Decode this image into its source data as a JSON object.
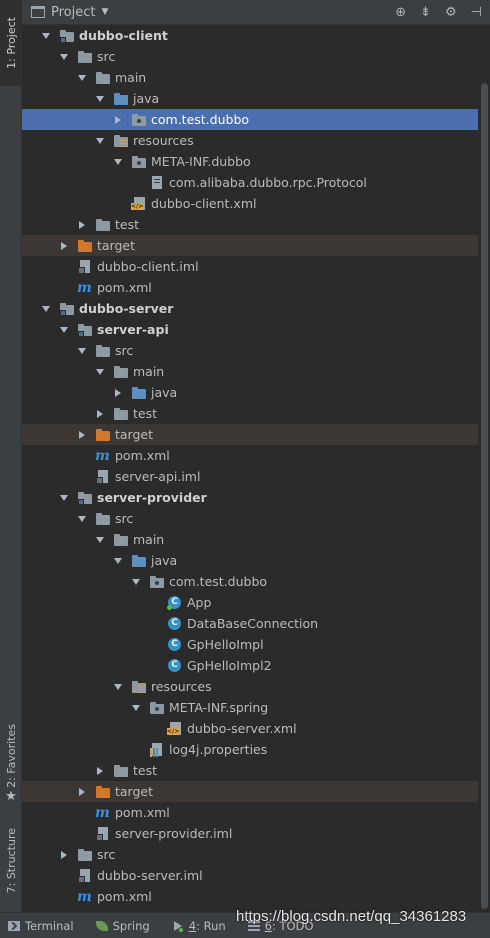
{
  "header": {
    "title": "Project"
  },
  "stripe": {
    "project": "1: Project",
    "favorites": "2: Favorites",
    "structure": "7: Structure"
  },
  "tree": [
    {
      "label": "dubbo-client",
      "indent": 0,
      "arrow": "down",
      "icon": "folder-module",
      "bold": true
    },
    {
      "label": "src",
      "indent": 1,
      "arrow": "down",
      "icon": "folder"
    },
    {
      "label": "main",
      "indent": 2,
      "arrow": "down",
      "icon": "folder"
    },
    {
      "label": "java",
      "indent": 3,
      "arrow": "down",
      "icon": "folder-java"
    },
    {
      "label": "com.test.dubbo",
      "indent": 4,
      "arrow": "right",
      "icon": "folder-package",
      "selected": true
    },
    {
      "label": "resources",
      "indent": 3,
      "arrow": "down",
      "icon": "folder-resources"
    },
    {
      "label": "META-INF.dubbo",
      "indent": 4,
      "arrow": "down",
      "icon": "folder-package"
    },
    {
      "label": "com.alibaba.dubbo.rpc.Protocol",
      "indent": 5,
      "arrow": "none",
      "icon": "file"
    },
    {
      "label": "dubbo-client.xml",
      "indent": 4,
      "arrow": "none",
      "icon": "xml"
    },
    {
      "label": "test",
      "indent": 2,
      "arrow": "right",
      "icon": "folder"
    },
    {
      "label": "target",
      "indent": 1,
      "arrow": "right",
      "icon": "folder-excluded",
      "excluded": true
    },
    {
      "label": "dubbo-client.iml",
      "indent": 1,
      "arrow": "none",
      "icon": "iml"
    },
    {
      "label": "pom.xml",
      "indent": 1,
      "arrow": "none",
      "icon": "maven"
    },
    {
      "label": "dubbo-server",
      "indent": 0,
      "arrow": "down",
      "icon": "folder-module",
      "bold": true
    },
    {
      "label": "server-api",
      "indent": 1,
      "arrow": "down",
      "icon": "folder-module",
      "bold": true
    },
    {
      "label": "src",
      "indent": 2,
      "arrow": "down",
      "icon": "folder"
    },
    {
      "label": "main",
      "indent": 3,
      "arrow": "down",
      "icon": "folder"
    },
    {
      "label": "java",
      "indent": 4,
      "arrow": "right",
      "icon": "folder-java"
    },
    {
      "label": "test",
      "indent": 3,
      "arrow": "right",
      "icon": "folder"
    },
    {
      "label": "target",
      "indent": 2,
      "arrow": "right",
      "icon": "folder-excluded",
      "excluded": true
    },
    {
      "label": "pom.xml",
      "indent": 2,
      "arrow": "none",
      "icon": "maven"
    },
    {
      "label": "server-api.iml",
      "indent": 2,
      "arrow": "none",
      "icon": "iml"
    },
    {
      "label": "server-provider",
      "indent": 1,
      "arrow": "down",
      "icon": "folder-module",
      "bold": true
    },
    {
      "label": "src",
      "indent": 2,
      "arrow": "down",
      "icon": "folder"
    },
    {
      "label": "main",
      "indent": 3,
      "arrow": "down",
      "icon": "folder"
    },
    {
      "label": "java",
      "indent": 4,
      "arrow": "down",
      "icon": "folder-java"
    },
    {
      "label": "com.test.dubbo",
      "indent": 5,
      "arrow": "down",
      "icon": "folder-package"
    },
    {
      "label": "App",
      "indent": 6,
      "arrow": "none",
      "icon": "class-runnable"
    },
    {
      "label": "DataBaseConnection",
      "indent": 6,
      "arrow": "none",
      "icon": "class"
    },
    {
      "label": "GpHelloImpl",
      "indent": 6,
      "arrow": "none",
      "icon": "class"
    },
    {
      "label": "GpHelloImpl2",
      "indent": 6,
      "arrow": "none",
      "icon": "class"
    },
    {
      "label": "resources",
      "indent": 4,
      "arrow": "down",
      "icon": "folder-resources"
    },
    {
      "label": "META-INF.spring",
      "indent": 5,
      "arrow": "down",
      "icon": "folder-package"
    },
    {
      "label": "dubbo-server.xml",
      "indent": 6,
      "arrow": "none",
      "icon": "xml"
    },
    {
      "label": "log4j.properties",
      "indent": 5,
      "arrow": "none",
      "icon": "properties"
    },
    {
      "label": "test",
      "indent": 3,
      "arrow": "right",
      "icon": "folder"
    },
    {
      "label": "target",
      "indent": 2,
      "arrow": "right",
      "icon": "folder-excluded",
      "excluded": true
    },
    {
      "label": "pom.xml",
      "indent": 2,
      "arrow": "none",
      "icon": "maven"
    },
    {
      "label": "server-provider.iml",
      "indent": 2,
      "arrow": "none",
      "icon": "iml"
    },
    {
      "label": "src",
      "indent": 1,
      "arrow": "right",
      "icon": "folder"
    },
    {
      "label": "dubbo-server.iml",
      "indent": 1,
      "arrow": "none",
      "icon": "iml"
    },
    {
      "label": "pom.xml",
      "indent": 1,
      "arrow": "none",
      "icon": "maven"
    }
  ],
  "bottom": {
    "terminal": "Terminal",
    "spring": "Spring",
    "run_num": "4",
    "run": ": Run",
    "todo_num": "6",
    "todo": ": TODO"
  },
  "watermark": "https://blog.csdn.net/qq_34361283"
}
